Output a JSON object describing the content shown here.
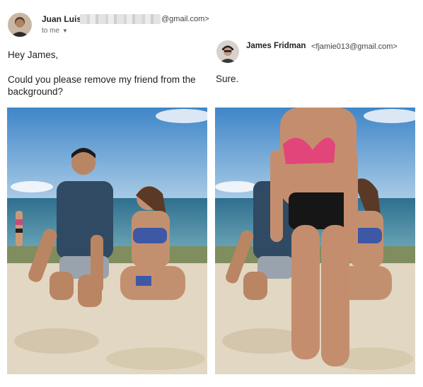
{
  "email": {
    "sender": {
      "name": "Juan Luis",
      "email_suffix": "@gmail.com>",
      "recipient_label": "to me",
      "avatar_icon": "person-avatar-icon"
    },
    "greeting": "Hey James,",
    "request": "Could you please remove my friend from the background?"
  },
  "reply": {
    "sender": {
      "name": "James Fridman",
      "email": "<fjamie013@gmail.com>",
      "avatar_icon": "person-avatar-icon"
    },
    "text": "Sure."
  },
  "photos": {
    "original": "beach photo of a man and a woman in a bikini kneeling on the sand",
    "edited": "edited beach photo with a woman in a pink bikini standing in front of the couple"
  },
  "colors": {
    "sky": "#6fa6d6",
    "sea": "#3e7f9c",
    "sand": "#e6dcc8",
    "pink_bikini": "#e2457a"
  }
}
